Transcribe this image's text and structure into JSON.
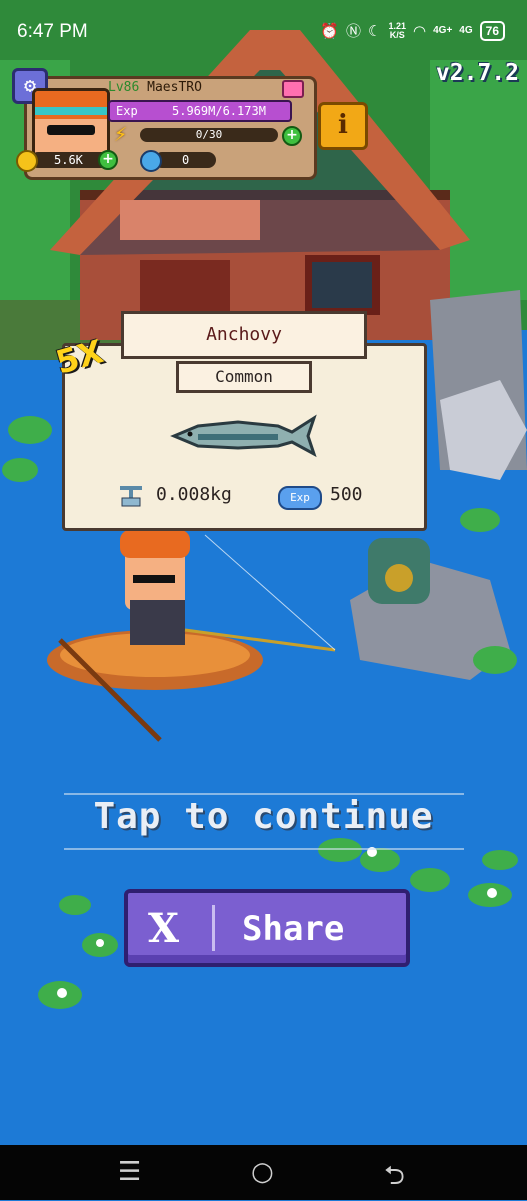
{
  "status_bar": {
    "time": "6:47 PM",
    "net_speed_value": "1.21",
    "net_speed_unit": "K/S",
    "signal1": "4G+",
    "signal2": "4G",
    "battery": "76"
  },
  "hud": {
    "level": "Lv86",
    "player_name": "MaesTRO",
    "exp_label": "Exp",
    "exp_value": "5.969M/6.173M",
    "energy": "0/30",
    "coins": "5.6K",
    "gems": "0",
    "version": "v2.7.2",
    "info_label": "i"
  },
  "catch": {
    "multiplier": "5X",
    "fish_name": "Anchovy",
    "rarity": "Common",
    "weight": "0.008kg",
    "exp_badge": "Exp",
    "exp_amount": "500"
  },
  "prompt": {
    "tap_to_continue": "Tap to continue",
    "share_label": "Share",
    "share_icon_glyph": "X"
  },
  "nav": {
    "recents_glyph": "☰",
    "home_glyph": "○",
    "back_glyph": "⮌"
  },
  "colors": {
    "water": "#1d7ad6",
    "share_button": "#7b5fd0",
    "card": "#f6eedb",
    "exp_bar": "#b74fd0"
  }
}
